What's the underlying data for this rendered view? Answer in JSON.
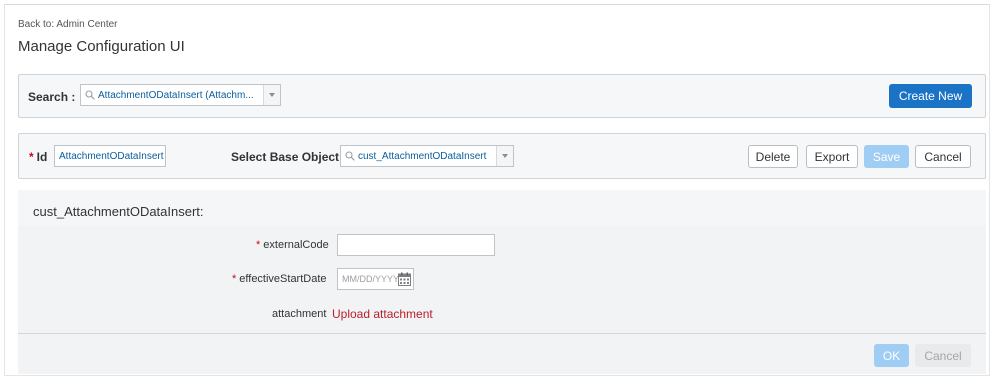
{
  "header": {
    "back_link": "Back to: Admin Center",
    "title": "Manage Configuration UI"
  },
  "search": {
    "label": "Search :",
    "value": "AttachmentODataInsert (Attachm...",
    "create_button": "Create New"
  },
  "config": {
    "required_marker": "*",
    "id_label": "Id",
    "id_value": "AttachmentODataInsert",
    "base_object_label": "Select Base Object",
    "base_object_value": "cust_AttachmentODataInsert",
    "buttons": {
      "delete": "Delete",
      "export": "Export",
      "save": "Save",
      "cancel": "Cancel"
    }
  },
  "form": {
    "title": "cust_AttachmentODataInsert:",
    "fields": {
      "external_code_label": "externalCode",
      "external_code_value": "",
      "effective_start_date_label": "effectiveStartDate",
      "effective_start_date_placeholder": "MM/DD/YYYY",
      "attachment_label": "attachment",
      "upload_link": "Upload attachment"
    },
    "footer": {
      "ok": "OK",
      "cancel": "Cancel"
    }
  },
  "colors": {
    "primary": "#1a73c4",
    "primary_disabled": "#9fcdf3",
    "required": "#d0021b",
    "link_red": "#b8202b",
    "value_blue": "#0a5d9e"
  },
  "icons": [
    "search-icon",
    "chevron-down-icon",
    "calendar-icon"
  ]
}
